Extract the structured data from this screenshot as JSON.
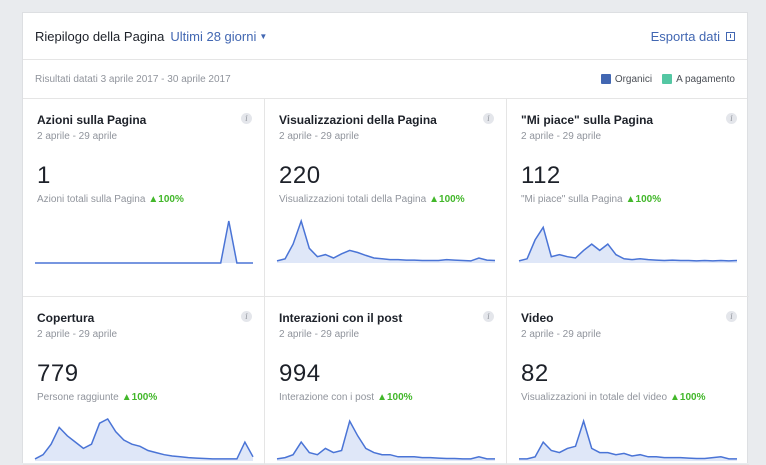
{
  "header": {
    "title": "Riepilogo della Pagina",
    "period": "Ultimi 28 giorni",
    "export_label": "Esporta dati"
  },
  "subheader": {
    "range_text": "Risultati datati 3 aprile 2017 - 30 aprile 2017",
    "legend": [
      {
        "label": "Organici",
        "color": "#4267b2"
      },
      {
        "label": "A pagamento",
        "color": "#54c7a3"
      }
    ]
  },
  "colors": {
    "line": "#4a74d6",
    "fill": "#dfe7f8",
    "positive": "#42b72a"
  },
  "cards": [
    {
      "title": "Azioni sulla Pagina",
      "date": "2 aprile - 29 aprile",
      "value": "1",
      "caption": "Azioni totali sulla Pagina",
      "delta": "▲100%",
      "trend": [
        0,
        0,
        0,
        0,
        0,
        0,
        0,
        0,
        0,
        0,
        0,
        0,
        0,
        0,
        0,
        0,
        0,
        0,
        0,
        0,
        0,
        0,
        0,
        0,
        1,
        0,
        0,
        0
      ]
    },
    {
      "title": "Visualizzazioni della Pagina",
      "date": "2 aprile - 29 aprile",
      "value": "220",
      "caption": "Visualizzazioni totali della Pagina",
      "delta": "▲100%",
      "trend": [
        0.05,
        0.1,
        0.45,
        1,
        0.35,
        0.15,
        0.2,
        0.12,
        0.22,
        0.3,
        0.25,
        0.18,
        0.12,
        0.1,
        0.08,
        0.08,
        0.07,
        0.07,
        0.06,
        0.06,
        0.06,
        0.08,
        0.07,
        0.06,
        0.05,
        0.12,
        0.07,
        0.06
      ]
    },
    {
      "title": "\"Mi piace\" sulla Pagina",
      "date": "2 aprile - 29 aprile",
      "value": "112",
      "caption": "\"Mi piace\" sulla Pagina",
      "delta": "▲100%",
      "trend": [
        0.05,
        0.1,
        0.55,
        0.85,
        0.15,
        0.2,
        0.15,
        0.12,
        0.3,
        0.45,
        0.3,
        0.45,
        0.2,
        0.1,
        0.08,
        0.1,
        0.08,
        0.07,
        0.06,
        0.07,
        0.06,
        0.06,
        0.05,
        0.06,
        0.05,
        0.06,
        0.05,
        0.06
      ]
    },
    {
      "title": "Copertura",
      "date": "2 aprile - 29 aprile",
      "value": "779",
      "caption": "Persone raggiunte",
      "delta": "▲100%",
      "trend": [
        0.05,
        0.15,
        0.4,
        0.8,
        0.6,
        0.45,
        0.3,
        0.4,
        0.9,
        1,
        0.7,
        0.5,
        0.4,
        0.35,
        0.25,
        0.2,
        0.15,
        0.12,
        0.1,
        0.08,
        0.07,
        0.06,
        0.05,
        0.05,
        0.05,
        0.05,
        0.45,
        0.1
      ]
    },
    {
      "title": "Interazioni con il post",
      "date": "2 aprile - 29 aprile",
      "value": "994",
      "caption": "Interazione con i post",
      "delta": "▲100%",
      "trend": [
        0.05,
        0.08,
        0.15,
        0.45,
        0.2,
        0.15,
        0.3,
        0.2,
        0.25,
        0.95,
        0.6,
        0.3,
        0.2,
        0.15,
        0.15,
        0.1,
        0.1,
        0.1,
        0.08,
        0.08,
        0.07,
        0.06,
        0.06,
        0.05,
        0.05,
        0.1,
        0.05,
        0.05
      ]
    },
    {
      "title": "Video",
      "date": "2 aprile - 29 aprile",
      "value": "82",
      "caption": "Visualizzazioni in totale del video",
      "delta": "▲100%",
      "trend": [
        0.05,
        0.05,
        0.1,
        0.45,
        0.25,
        0.2,
        0.3,
        0.35,
        0.95,
        0.3,
        0.2,
        0.2,
        0.15,
        0.18,
        0.12,
        0.15,
        0.1,
        0.1,
        0.08,
        0.08,
        0.08,
        0.07,
        0.06,
        0.06,
        0.08,
        0.1,
        0.05,
        0.05
      ]
    }
  ]
}
